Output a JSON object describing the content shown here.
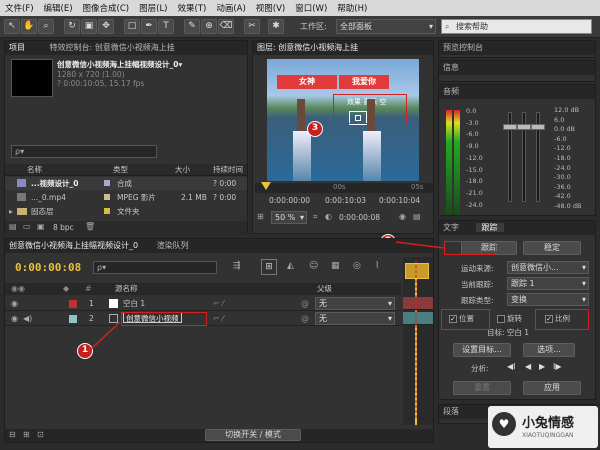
{
  "menu": [
    "文件(F)",
    "编辑(E)",
    "图像合成(C)",
    "图层(L)",
    "效果(T)",
    "动画(A)",
    "视图(V)",
    "窗口(W)",
    "帮助(H)"
  ],
  "toolbar": {
    "workspace_label": "工作区:",
    "workspace_value": "全部面板",
    "search_placeholder": "搜索帮助"
  },
  "project": {
    "tab_project": "项目",
    "tab_effects": "特效控制台: 创意微信小视频海上挂",
    "comp_name": "创意微信小视频海上挂幅视频设计_0▾",
    "comp_res": "1280 x 720 (1.00)",
    "comp_dur": "? 0:00:10:05, 15.17 fps",
    "search_placeholder": "ρ▾",
    "cols": {
      "name": "名称",
      "type": "类型",
      "size": "大小",
      "duration": "持续时间"
    },
    "items": [
      {
        "name": "...视频设计_0",
        "type": "合成",
        "size": "",
        "dur": "? 0:00"
      },
      {
        "name": "..._0.mp4",
        "type": "MPEG 影片",
        "size": "2.1 MB",
        "dur": "? 0:00"
      },
      {
        "name": "固态层",
        "type": "文件夹",
        "size": "",
        "dur": ""
      }
    ],
    "bpc": "8 bpc"
  },
  "comp": {
    "tab": "图层: 创意微信小视频海上挂",
    "video_text_left": "女神",
    "video_text_right": "我爱你",
    "video_text_small": "效果 喜乐 空",
    "ruler_a": "00s",
    "ruler_b": "05s",
    "time_1": "0:00:00:00",
    "time_2": "0:00:10:03",
    "time_3": "0:00:10:04",
    "zoom": "50 %",
    "cam": "0:00:00:08",
    "res": "完整"
  },
  "right": {
    "preview": "预览控制台",
    "info": "信息",
    "audio": "音频",
    "db_left": [
      "0.0",
      "-3.0",
      "-6.0",
      "-9.0",
      "-12.0",
      "-15.0",
      "-18.0",
      "-21.0",
      "-24.0"
    ],
    "db_right": [
      "12.0 dB",
      "6.0",
      "0.0 dB",
      "-6.0",
      "-12.0",
      "-18.0",
      "-24.0",
      "-30.0",
      "-36.0",
      "-42.0",
      "-48.0 dB"
    ]
  },
  "tracker": {
    "tab_text": "文字",
    "tab_tracker": "跟踪",
    "btn_track": "跟踪",
    "btn_stabilize": "稳定",
    "motion_source_label": "运动来源:",
    "motion_source_value": "创意微信小...",
    "current_track_label": "当前跟踪:",
    "current_track_value": "跟踪 1",
    "track_type_label": "跟踪类型:",
    "track_type_value": "变换",
    "opt_position": "位置",
    "opt_rotation": "旋转",
    "opt_scale": "比例",
    "target": "目标: 空白 1",
    "btn_set_target": "设置目标...",
    "btn_options": "选项...",
    "analyze_label": "分析:",
    "btn_reset": "重置",
    "btn_apply": "应用",
    "paragraph": "段落"
  },
  "timeline": {
    "tab_comp": "创意微信小视频海上挂幅视频设计_0",
    "tab_render": "渲染队列",
    "timecode": "0:00:00:08",
    "col_source": "源名称",
    "col_parent": "父级",
    "layers": [
      {
        "num": "1",
        "name": "空白 1",
        "parent": "无",
        "color": "#c03030"
      },
      {
        "num": "2",
        "name": "创意微信小视频",
        "parent": "无",
        "color": "#8fc4c4"
      }
    ],
    "switch_mode": "切换开关 / 模式"
  },
  "annotations": [
    "1",
    "2",
    "3"
  ],
  "watermark": {
    "name": "小兔情感",
    "sub": "XIAOTUQINGGAN"
  }
}
